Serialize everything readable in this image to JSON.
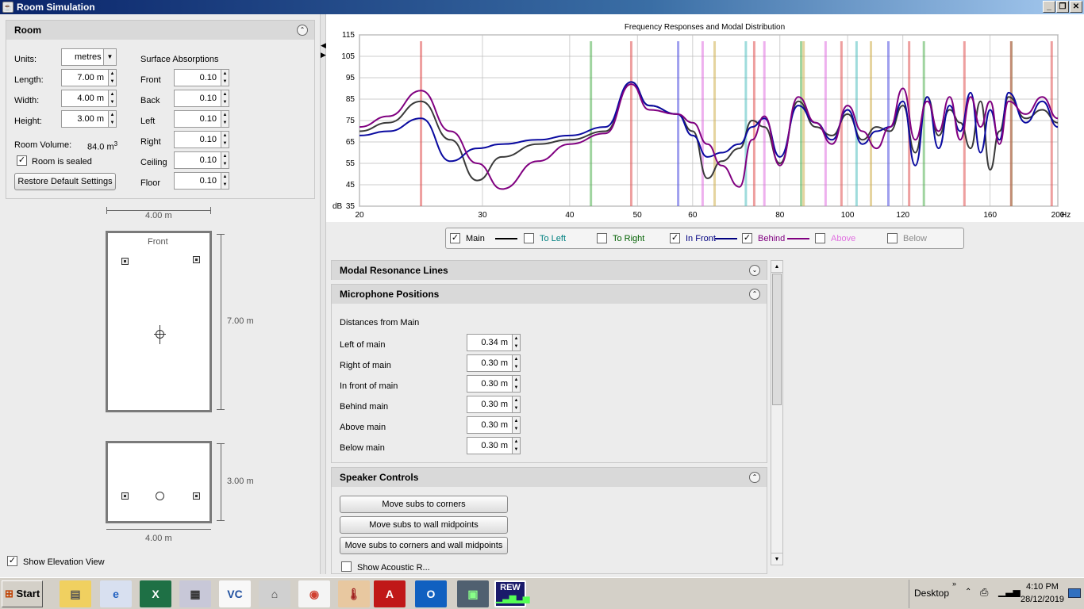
{
  "window": {
    "title": "Room Simulation"
  },
  "room_panel": {
    "title": "Room",
    "units_label": "Units:",
    "units_value": "metres",
    "length_label": "Length:",
    "length_value": "7.00 m",
    "width_label": "Width:",
    "width_value": "4.00 m",
    "height_label": "Height:",
    "height_value": "3.00 m",
    "volume_label": "Room Volume:",
    "volume_value": "84.0 m",
    "volume_sup": "3",
    "sealed_label": "Room is sealed",
    "restore_label": "Restore Default Settings",
    "absorptions_title": "Surface Absorptions",
    "surfaces": [
      {
        "label": "Front",
        "value": "0.10"
      },
      {
        "label": "Back",
        "value": "0.10"
      },
      {
        "label": "Left",
        "value": "0.10"
      },
      {
        "label": "Right",
        "value": "0.10"
      },
      {
        "label": "Ceiling",
        "value": "0.10"
      },
      {
        "label": "Floor",
        "value": "0.10"
      }
    ]
  },
  "plan": {
    "top_width": "4.00 m",
    "front_label": "Front",
    "length": "7.00 m",
    "height": "3.00 m",
    "bottom_width": "4.00 m"
  },
  "show_elevation_label": "Show Elevation View",
  "chart_data": {
    "type": "line",
    "title": "Frequency Responses and Modal Distribution",
    "ylabel": "dB",
    "xunit": "Hz",
    "xscale": "log",
    "xlim": [
      20,
      200
    ],
    "ylim": [
      35,
      115
    ],
    "xticks": [
      20,
      30,
      40,
      50,
      60,
      80,
      100,
      120,
      160,
      200
    ],
    "yticks": [
      35,
      45,
      55,
      65,
      75,
      85,
      95,
      105,
      115
    ],
    "series": [
      {
        "name": "Main",
        "color": "#3a3a3a",
        "x": [
          20,
          22,
          24.5,
          27,
          29.5,
          32,
          36,
          40,
          45,
          49,
          52,
          57,
          60,
          63,
          66,
          70,
          73,
          76,
          80,
          85,
          90,
          95,
          100,
          105,
          110,
          115,
          120,
          125,
          130,
          135,
          140,
          145,
          150,
          155,
          160,
          165,
          170,
          180,
          190,
          200
        ],
        "y": [
          70,
          74,
          84,
          66,
          47,
          58,
          64,
          66,
          70,
          93,
          82,
          78,
          70,
          48,
          56,
          62,
          75,
          72,
          55,
          84,
          72,
          68,
          78,
          66,
          72,
          70,
          82,
          60,
          86,
          68,
          80,
          74,
          62,
          84,
          52,
          70,
          86,
          76,
          80,
          74
        ]
      },
      {
        "name": "In Front",
        "color": "#0a0aa0",
        "x": [
          20,
          22,
          24.5,
          27,
          29.5,
          32,
          36,
          40,
          45,
          49,
          52,
          57,
          60,
          63,
          66,
          70,
          73,
          76,
          80,
          85,
          90,
          95,
          100,
          105,
          110,
          115,
          120,
          125,
          130,
          135,
          140,
          145,
          150,
          155,
          160,
          165,
          170,
          180,
          190,
          200
        ],
        "y": [
          68,
          70,
          76,
          56,
          62,
          64,
          66,
          68,
          72,
          93,
          82,
          78,
          68,
          58,
          60,
          64,
          72,
          76,
          58,
          82,
          74,
          66,
          80,
          64,
          70,
          72,
          84,
          54,
          86,
          62,
          82,
          70,
          88,
          60,
          80,
          66,
          88,
          74,
          84,
          72
        ]
      },
      {
        "name": "Behind",
        "color": "#800080",
        "x": [
          20,
          22,
          24.5,
          27,
          29.5,
          32,
          36,
          40,
          45,
          49,
          52,
          57,
          60,
          63,
          66,
          70,
          73,
          76,
          80,
          85,
          90,
          95,
          100,
          105,
          110,
          115,
          120,
          125,
          130,
          135,
          140,
          145,
          150,
          155,
          160,
          165,
          170,
          180,
          190,
          200
        ],
        "y": [
          72,
          77,
          89,
          70,
          55,
          43,
          56,
          64,
          69,
          92,
          80,
          78,
          74,
          64,
          54,
          44,
          66,
          77,
          54,
          86,
          74,
          64,
          82,
          70,
          62,
          72,
          90,
          66,
          84,
          70,
          86,
          66,
          86,
          72,
          84,
          64,
          84,
          78,
          86,
          76
        ]
      }
    ],
    "modal_lines": [
      {
        "freq": 24.5,
        "color": "#e05050"
      },
      {
        "freq": 42.9,
        "color": "#50b050"
      },
      {
        "freq": 49,
        "color": "#e05050"
      },
      {
        "freq": 57.2,
        "color": "#5050e0"
      },
      {
        "freq": 62,
        "color": "#e070e0"
      },
      {
        "freq": 64.5,
        "color": "#d0b050"
      },
      {
        "freq": 71.5,
        "color": "#50c0c0"
      },
      {
        "freq": 73.5,
        "color": "#e05050"
      },
      {
        "freq": 76,
        "color": "#e070e0"
      },
      {
        "freq": 85.8,
        "color": "#50b050"
      },
      {
        "freq": 86.5,
        "color": "#d0b050"
      },
      {
        "freq": 93,
        "color": "#e070e0"
      },
      {
        "freq": 98,
        "color": "#e05050"
      },
      {
        "freq": 103,
        "color": "#50c0c0"
      },
      {
        "freq": 108,
        "color": "#d0b050"
      },
      {
        "freq": 114.4,
        "color": "#5050e0"
      },
      {
        "freq": 122.5,
        "color": "#e05050"
      },
      {
        "freq": 128.6,
        "color": "#50b050"
      },
      {
        "freq": 147,
        "color": "#e05050"
      },
      {
        "freq": 171.6,
        "color": "#50b050"
      },
      {
        "freq": 171.5,
        "color": "#e05050"
      },
      {
        "freq": 196,
        "color": "#e05050"
      }
    ]
  },
  "legend": [
    {
      "label": "Main",
      "checked": true,
      "color": "#000000"
    },
    {
      "label": "To Left",
      "checked": false,
      "color": "#008080"
    },
    {
      "label": "To Right",
      "checked": false,
      "color": "#006000"
    },
    {
      "label": "In Front",
      "checked": true,
      "color": "#000080"
    },
    {
      "label": "Behind",
      "checked": true,
      "color": "#800080"
    },
    {
      "label": "Above",
      "checked": false,
      "color": "#e070e0"
    },
    {
      "label": "Below",
      "checked": false,
      "color": "#8a8a8a"
    }
  ],
  "modal_panel": {
    "title": "Modal Resonance Lines"
  },
  "mic_panel": {
    "title": "Microphone Positions",
    "subtitle": "Distances from Main",
    "rows": [
      {
        "label": "Left of main",
        "value": "0.34 m"
      },
      {
        "label": "Right of main",
        "value": "0.30 m"
      },
      {
        "label": "In front of main",
        "value": "0.30 m"
      },
      {
        "label": "Behind main",
        "value": "0.30 m"
      },
      {
        "label": "Above main",
        "value": "0.30 m"
      },
      {
        "label": "Below main",
        "value": "0.30 m"
      }
    ]
  },
  "speaker_panel": {
    "title": "Speaker Controls",
    "buttons": [
      "Move subs to corners",
      "Move subs to wall midpoints",
      "Move subs to corners and wall midpoints"
    ],
    "partial_label": "Show Acoustic R..."
  },
  "taskbar": {
    "start_label": "Start",
    "apps": [
      "explorer-icon",
      "ie-icon",
      "excel-icon",
      "calculator-icon",
      "vnc-icon",
      "network-icon",
      "chrome-icon",
      "thermometer-icon",
      "acrobat-icon",
      "outlook-icon",
      "monitor-icon",
      "rew-icon"
    ],
    "rew_label": "REW",
    "desktop_label": "Desktop",
    "time": "4:10 PM",
    "date": "28/12/2019"
  }
}
